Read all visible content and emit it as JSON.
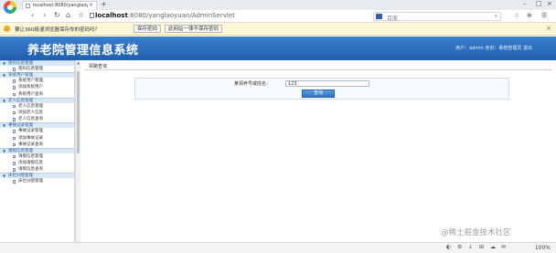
{
  "browser": {
    "tab_title": "localhost:8080/yanglaoyu",
    "tab_close": "×",
    "tab_add": "+",
    "nav": {
      "back": "‹",
      "forward": "›",
      "refresh": "↻",
      "home": "⌂",
      "bookmark": "☆"
    },
    "url_host": "localhost",
    "url_path": ":8080/yanglaoyuan/AdminServlet",
    "search_placeholder": "百度",
    "search_icon": "⌕",
    "tools": [
      "☆",
      "⊕",
      "☰"
    ],
    "window_controls": [
      "–",
      "□",
      "×"
    ]
  },
  "password_bar": {
    "message": "要让360极速浏览器保存你的密码吗？",
    "save_button": "保存密码",
    "never_button": "此网站一律不保存密码",
    "close": "×"
  },
  "header": {
    "title": "养老院管理信息系统",
    "user_info": "用户：admin 身份：系统管理员  退出"
  },
  "sidebar": {
    "groups": [
      {
        "title": "密码信息管理",
        "items": [
          "密码信息管理"
        ]
      },
      {
        "title": "系统用户管理",
        "items": [
          "系统用户管理",
          "添加系统用户",
          "系统用户查询"
        ]
      },
      {
        "title": "老人信息管理",
        "items": [
          "老人信息管理",
          "添加老人信息",
          "老人信息查询"
        ]
      },
      {
        "title": "事故记录管理",
        "items": [
          "事故记录管理",
          "添加事故记录",
          "事故记录查询"
        ]
      },
      {
        "title": "请假信息管理",
        "items": [
          "请假信息管理",
          "添加请假信息",
          "请假信息查询"
        ]
      },
      {
        "title": "床位分配管理",
        "items": [
          "床位分配管理"
        ]
      }
    ]
  },
  "main": {
    "breadcrumb": "领路查询",
    "form": {
      "label": "某领养号或姓名：",
      "input_value": "123",
      "button": "查询"
    }
  },
  "status": {
    "icons": [
      "◐",
      "⚙",
      "↓",
      "⊞",
      "☁",
      "✉"
    ],
    "zoom": "100%"
  },
  "watermark": "@稀土掘金技术社区"
}
